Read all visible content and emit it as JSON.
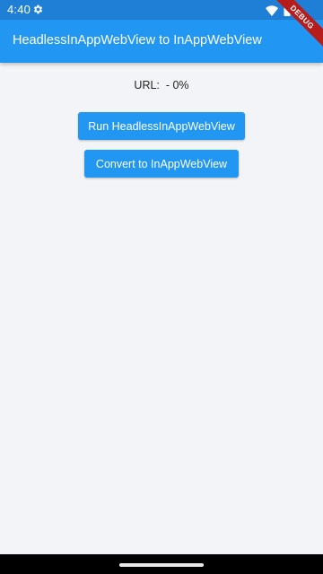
{
  "status_bar": {
    "time": "4:40",
    "icons": [
      "settings-icon",
      "wifi-icon",
      "battery-icon"
    ]
  },
  "app_bar": {
    "title": "HeadlessInAppWebView to InAppWebView",
    "color": "#2196f3"
  },
  "debug_banner": {
    "label": "DEBUG"
  },
  "main": {
    "url_label": "URL:  - 0%",
    "buttons": {
      "run_label": "Run HeadlessInAppWebView",
      "convert_label": "Convert to InAppWebView"
    }
  },
  "colors": {
    "accent": "#2196f3",
    "status_bar": "#1f7fd6",
    "background": "#f3f4f7",
    "debug_ribbon": "#b71c1c"
  }
}
